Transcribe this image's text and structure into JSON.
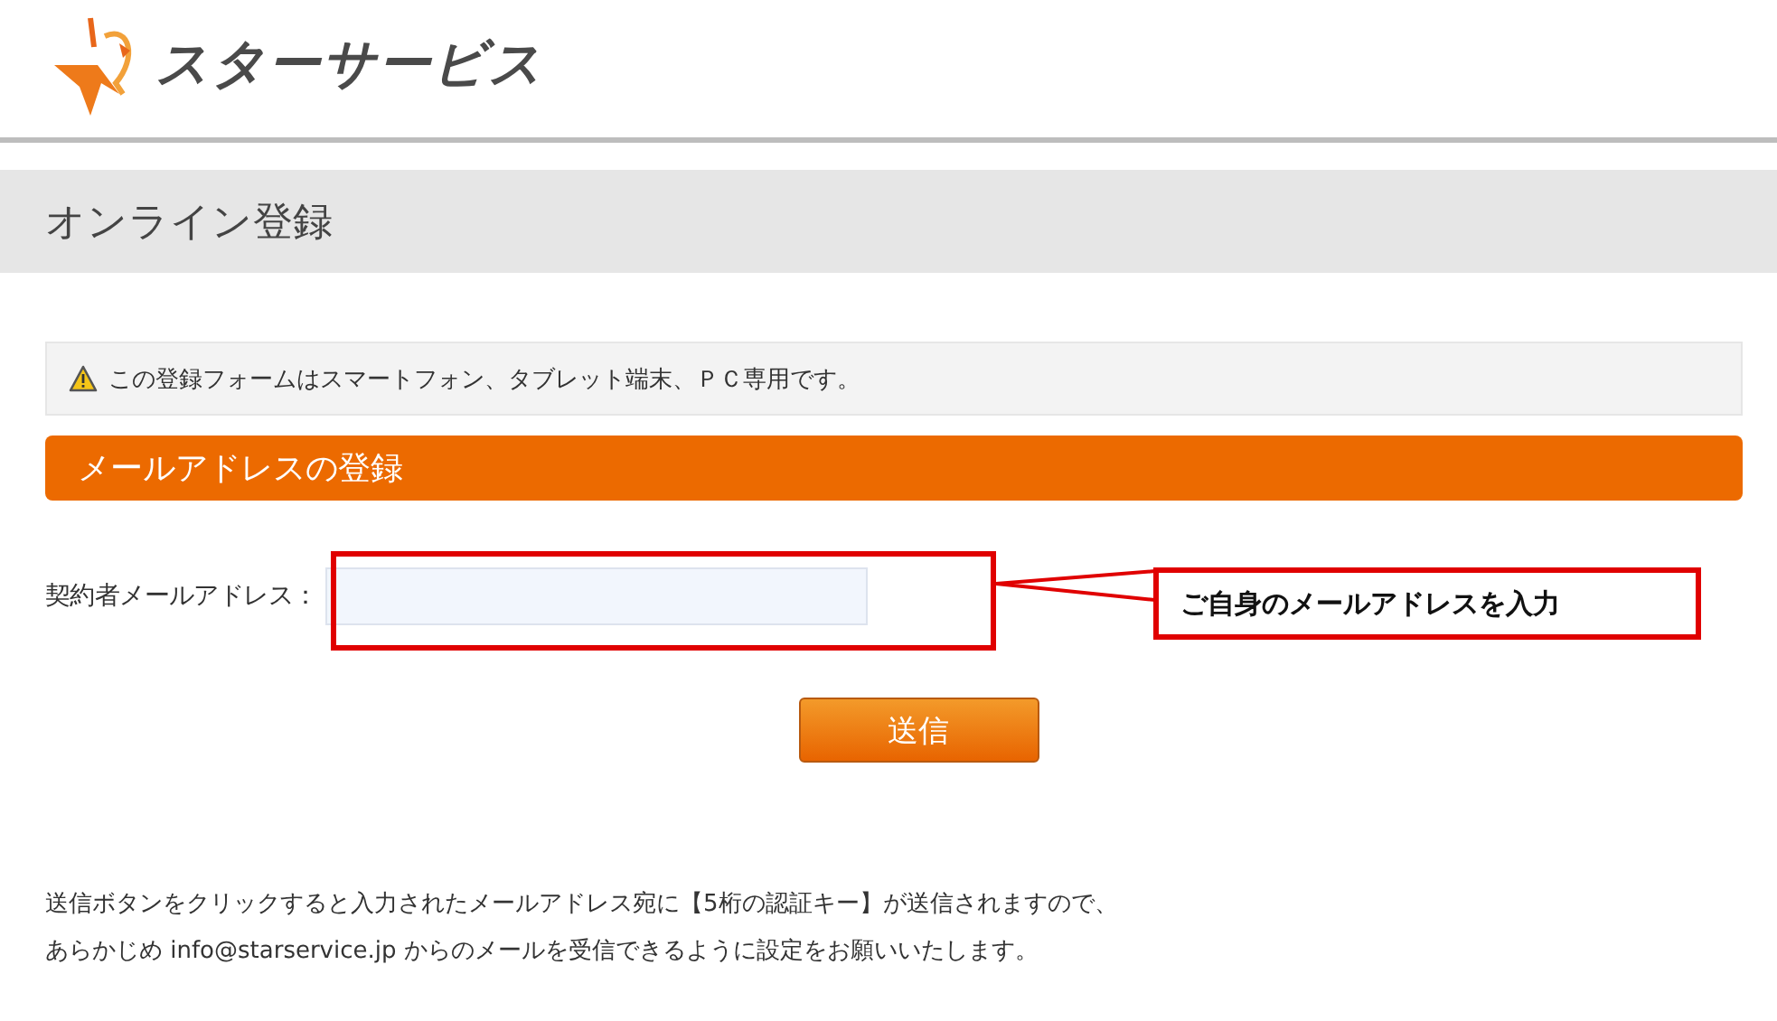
{
  "header": {
    "logo_text": "スターサービス"
  },
  "page_title": "オンライン登録",
  "notice": {
    "text": "この登録フォームはスマートフォン、タブレット端末、ＰＣ専用です。"
  },
  "section": {
    "title": "メールアドレスの登録"
  },
  "form": {
    "label": "契約者メールアドレス："
  },
  "callout": {
    "text": "ご自身のメールアドレスを入力"
  },
  "submit_button": "送信",
  "footer_lines": [
    "送信ボタンをクリックすると入力されたメールアドレス宛に【5桁の認証キー】が送信されますので、",
    "あらかじめ info@starservice.jp からのメールを受信できるように設定をお願いいたします。"
  ]
}
